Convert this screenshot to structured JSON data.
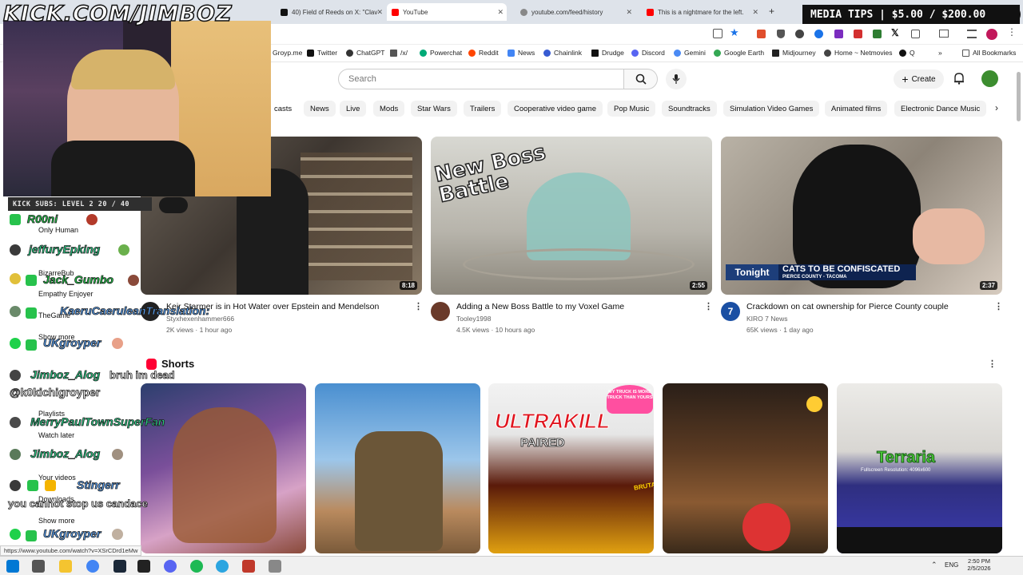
{
  "stream": {
    "channel_url": "KICK.COM/JIMBOZ",
    "media_tips": "MEDIA TIPS | $5.00 / $200.00",
    "kick_subs": "KICK SUBS: LEVEL 2 20 / 40",
    "chat": [
      {
        "user": "R00ni",
        "color": "#1fd14a"
      },
      {
        "user": "jeffuryEpking",
        "color": "#2ad58b"
      },
      {
        "user": "Jack_Gumbo",
        "color": "#1fd14a"
      },
      {
        "user": "KaeruCaeruleanTranslation:",
        "color": "#5aa7ff"
      },
      {
        "user": "UKgroyper",
        "color": "#5aa7ff"
      },
      {
        "user": "Jimboz_Alog",
        "color": "#2ad58b",
        "message": "bruh im dead"
      },
      {
        "user": "@k0kichigroyper",
        "color": "#ffffff"
      },
      {
        "user": "MerryPaulTownSuperFan",
        "color": "#2ad58b"
      },
      {
        "user": "Jimboz_Alog",
        "color": "#2ad58b"
      },
      {
        "user": "Stingerr",
        "color": "#5aa7ff"
      },
      {
        "user": "you cannot stop us candace",
        "color": "#ffffff"
      },
      {
        "user": "UKgroyper",
        "color": "#5aa7ff"
      }
    ]
  },
  "browser": {
    "tabs": [
      {
        "label": "40) Field of Reeds on X: \"Clav",
        "active": false
      },
      {
        "label": "YouTube",
        "active": true
      },
      {
        "label": "youtube.com/feed/history",
        "active": false
      },
      {
        "label": "This is a nightmare for the left.",
        "active": false
      }
    ],
    "new_tab": "+",
    "bookmarks": [
      "Groyp.me",
      "Twitter",
      "ChatGPT",
      "/x/",
      "Powerchat",
      "Reddit",
      "News",
      "Chainlink",
      "Drudge",
      "Discord",
      "Gemini",
      "Google Earth",
      "Midjourney",
      "Home ~ Netmovies",
      "Q"
    ],
    "all_bookmarks": "All Bookmarks",
    "status_url": "https://www.youtube.com/watch?v=XSrCDrd1eMw"
  },
  "youtube": {
    "search_placeholder": "Search",
    "create_label": "Create",
    "chips": [
      "casts",
      "News",
      "Live",
      "Mods",
      "Star Wars",
      "Trailers",
      "Cooperative video game",
      "Pop Music",
      "Soundtracks",
      "Simulation Video Games",
      "Animated films",
      "Electronic Dance Music"
    ],
    "videos": [
      {
        "title": "Keir Starmer is in Hot Water over Epstein and Mendelson",
        "channel": "Styxhexenhammer666",
        "meta": "2K views · 1 hour ago",
        "duration": "8:18"
      },
      {
        "title": "Adding a New Boss Battle to my Voxel Game",
        "channel": "Tooley1998",
        "meta": "4.5K views · 10 hours ago",
        "duration": "2:55",
        "overlay": "New Boss Battle"
      },
      {
        "title": "Crackdown on cat ownership for Pierce County couple",
        "channel": "KIRO 7 News",
        "meta": "65K views · 1 day ago",
        "duration": "2:37",
        "banner": "CATS TO BE CONFISCATED",
        "banner_sub": "PIERCE COUNTY - TACOMA",
        "banner_tag": "Tonight"
      }
    ],
    "shorts_title": "Shorts",
    "shorts": [
      {
        "overlay": ""
      },
      {
        "overlay": ""
      },
      {
        "overlay": "ULTRAKILL",
        "sub": "PAIRED",
        "bubble": "MY TRUCK IS MORE TRUCK THAN YOURS",
        "brutal": "BRUTAL"
      },
      {
        "overlay": ""
      },
      {
        "overlay": "Terraria",
        "sub": "Fullscreen Resolution: 4096x600"
      }
    ],
    "sidebar": [
      "Only Human",
      "BizarreBub",
      "Empathy Enjoyer",
      "TheGame",
      "Show more",
      "Playlists",
      "Watch later",
      "Your videos",
      "Downloads",
      "Show more"
    ]
  },
  "taskbar": {
    "lang": "ENG",
    "time": "2:50 PM",
    "date": "2/5/2026"
  }
}
